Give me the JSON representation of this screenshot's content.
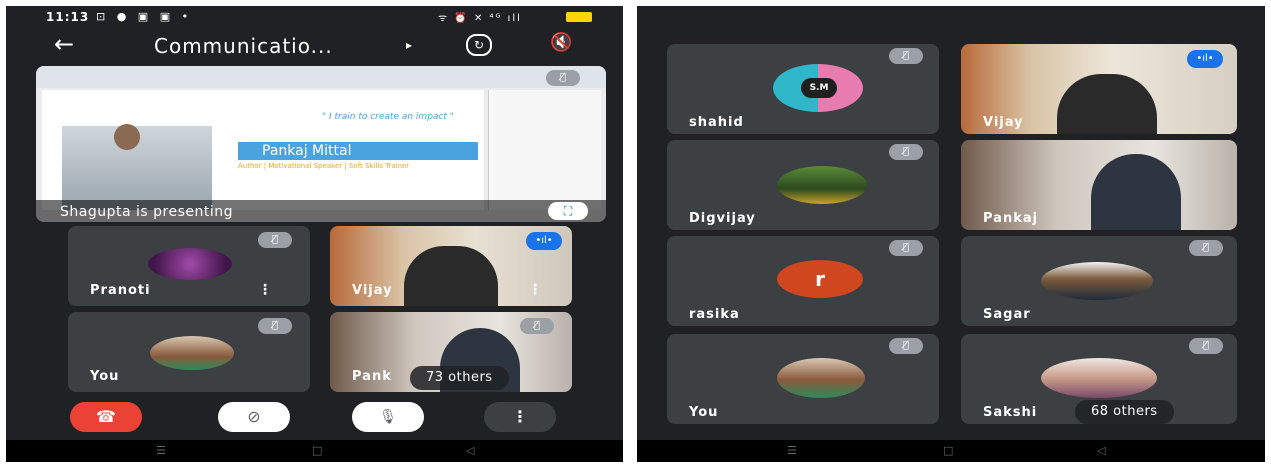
{
  "left": {
    "status_bar": {
      "time": "11:13",
      "icons_left": "⊡ ● ▣ ▣ •",
      "icons_right": "ᯤ ⏰ ✕ ⁴ᴳ ıll"
    },
    "app_bar": {
      "title": "Communicatio...",
      "back_icon": "arrow-back-icon",
      "play_icon": "▸",
      "switch_camera_icon": "camera-switch-icon",
      "speaker_icon": "speaker-off-icon"
    },
    "presentation": {
      "quote": "\" I train to create an impact \"",
      "presenter_name": "Pankaj Mittal",
      "subtitle": "Author | Motivational Speaker | Soft Skills Trainer",
      "label": "Shagupta is presenting",
      "fullscreen_icon": "⛶"
    },
    "tiles": [
      {
        "name": "Pranoti",
        "muted": true
      },
      {
        "name": "Vijay",
        "muted": false
      },
      {
        "name": "You",
        "muted": true
      },
      {
        "name": "Pank",
        "muted": true,
        "others": "73 others"
      }
    ],
    "controls": {
      "end_call_icon": "☎",
      "video_off_icon": "⊘",
      "mic_off_icon": "🎙",
      "more_icon": "⋮"
    },
    "colors": {
      "end_call": "#ea4335",
      "tile_bg": "#3c4043",
      "screen_bg": "#202124",
      "speaking": "#1a73e8"
    }
  },
  "right": {
    "tiles": [
      {
        "name": "shahid",
        "avatar_text": "S.M"
      },
      {
        "name": "Vijay"
      },
      {
        "name": "Digvijay"
      },
      {
        "name": "Pankaj"
      },
      {
        "name": "rasika",
        "avatar_text": "r"
      },
      {
        "name": "Sagar"
      },
      {
        "name": "You"
      },
      {
        "name": "Sakshi",
        "others": "68 others"
      }
    ]
  },
  "mute_glyph": "🎙̸",
  "speaking_glyph": "•ıl•"
}
